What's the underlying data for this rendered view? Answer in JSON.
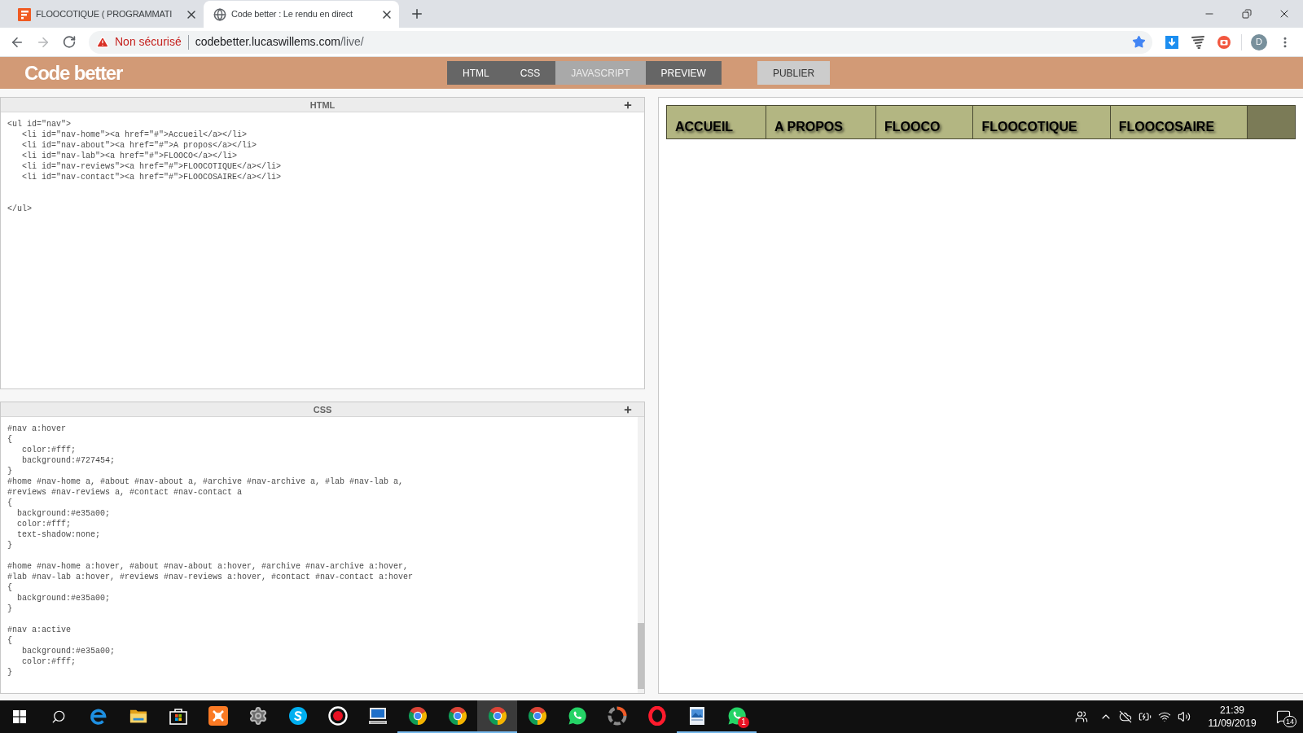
{
  "browser": {
    "tabs": [
      {
        "title": "FLOOCOTIQUE ( PROGRAMMATI",
        "kind": "site-logo",
        "selected": false
      },
      {
        "title": "Code better : Le rendu en direct",
        "kind": "globe",
        "selected": true
      }
    ],
    "address_bar": {
      "security": "Non sécurisé",
      "host": "codebetter.lucaswillems.com",
      "path": "/live/"
    },
    "profile_initial": "D"
  },
  "app": {
    "logo": "Code better",
    "view_tabs": [
      {
        "label": "HTML",
        "on": true
      },
      {
        "label": "CSS",
        "on": true
      },
      {
        "label": "JAVASCRIPT",
        "on": false
      },
      {
        "label": "PREVIEW",
        "on": true
      }
    ],
    "publish_button": "PUBLIER"
  },
  "editors": [
    {
      "title": "HTML",
      "code": "<ul id=\"nav\">\n   <li id=\"nav-home\"><a href=\"#\">Accueil</a></li>\n   <li id=\"nav-about\"><a href=\"#\">A propos</a></li>\n   <li id=\"nav-lab\"><a href=\"#\">FLOOCO</a></li>\n   <li id=\"nav-reviews\"><a href=\"#\">FLOOCOTIQUE</a></li>\n   <li id=\"nav-contact\"><a href=\"#\">FLOOCOSAIRE</a></li>\n\n\n</ul>",
      "scrollbar": false
    },
    {
      "title": "CSS",
      "code": "#nav a:hover\n{\n   color:#fff;\n   background:#727454;\n}\n#home #nav-home a, #about #nav-about a, #archive #nav-archive a, #lab #nav-lab a,\n#reviews #nav-reviews a, #contact #nav-contact a\n{\n  background:#e35a00;\n  color:#fff;\n  text-shadow:none;\n}\n\n#home #nav-home a:hover, #about #nav-about a:hover, #archive #nav-archive a:hover,\n#lab #nav-lab a:hover, #reviews #nav-reviews a:hover, #contact #nav-contact a:hover\n{\n  background:#e35a00;\n}\n\n#nav a:active\n{\n   background:#e35a00;\n   color:#fff;\n}",
      "scrollbar": true
    }
  ],
  "preview": {
    "nav_items": [
      "ACCUEIL",
      "A PROPOS",
      "FLOOCO",
      "FLOOCOTIQUE",
      "FLOOCOSAIRE"
    ]
  },
  "taskbar": {
    "apps": [
      {
        "kind": "edge",
        "running": false,
        "active": false
      },
      {
        "kind": "folder",
        "running": false,
        "active": false
      },
      {
        "kind": "store",
        "running": false,
        "active": false
      },
      {
        "kind": "xampp",
        "running": false,
        "active": false
      },
      {
        "kind": "gear",
        "running": false,
        "active": false
      },
      {
        "kind": "skype",
        "running": false,
        "active": false
      },
      {
        "kind": "record",
        "running": false,
        "active": false
      },
      {
        "kind": "monitor",
        "running": false,
        "active": false
      },
      {
        "kind": "chrome",
        "running": true,
        "active": false
      },
      {
        "kind": "chrome",
        "running": true,
        "active": false
      },
      {
        "kind": "chrome",
        "running": true,
        "active": true
      },
      {
        "kind": "chrome",
        "running": false,
        "active": false
      },
      {
        "kind": "whatsapp",
        "running": false,
        "active": false
      },
      {
        "kind": "ring",
        "running": false,
        "active": false
      },
      {
        "kind": "opera",
        "running": false,
        "active": false
      },
      {
        "kind": "picture",
        "running": true,
        "active": false
      },
      {
        "kind": "whatsapp",
        "running": true,
        "active": false,
        "badge": "1"
      }
    ],
    "time": "21:39",
    "date": "11/09/2019",
    "notification_count": "14"
  }
}
